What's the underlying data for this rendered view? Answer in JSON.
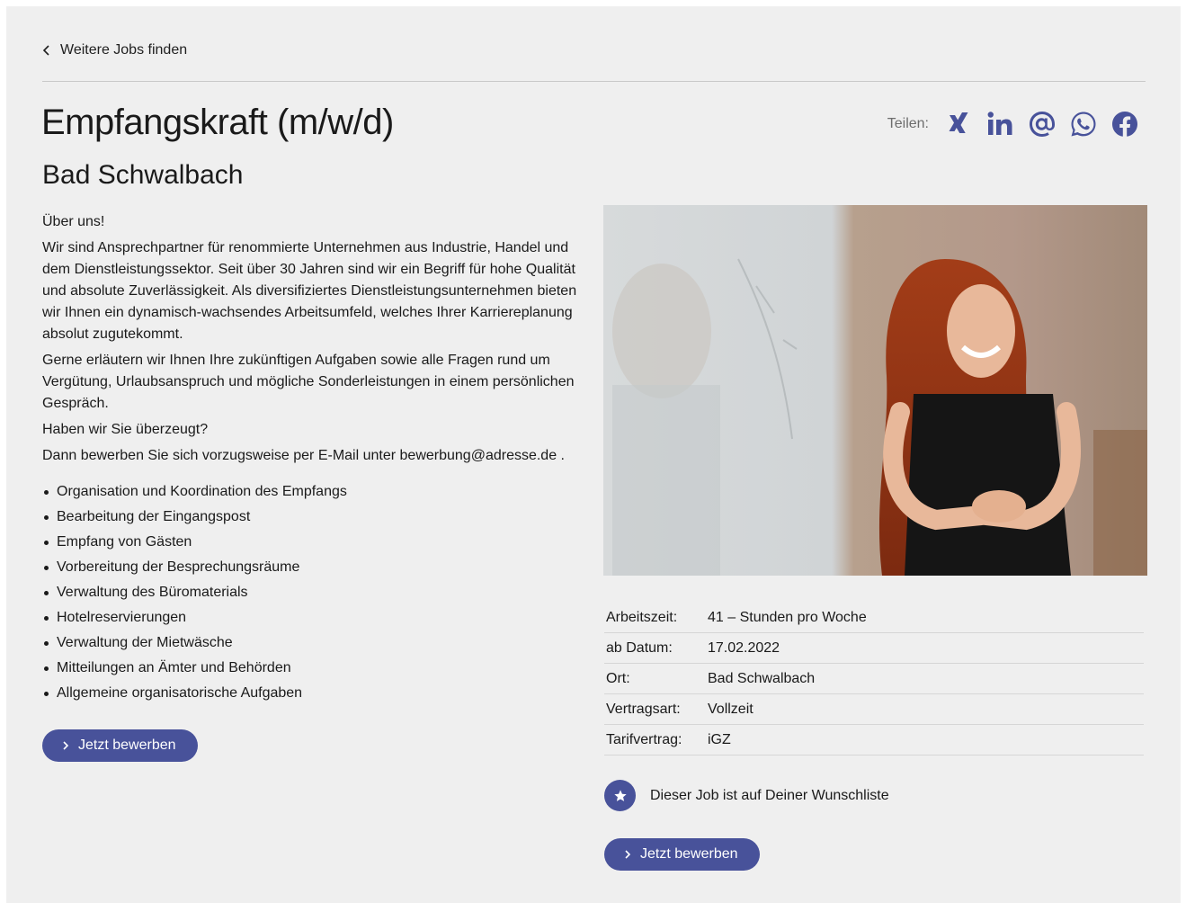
{
  "nav": {
    "back_label": "Weitere Jobs finden"
  },
  "job": {
    "title": "Empfangskraft (m/w/d)",
    "location": "Bad Schwalbach"
  },
  "share": {
    "label": "Teilen:",
    "icons": [
      "xing-icon",
      "linkedin-icon",
      "email-icon",
      "whatsapp-icon",
      "facebook-icon"
    ],
    "color": "#48529a"
  },
  "description": {
    "about_heading": "Über uns!",
    "about_text": "Wir sind Ansprechpartner für renommierte Unternehmen aus Industrie, Handel und dem Dienstleistungssektor. Seit über 30 Jahren sind wir ein Begriff für hohe Qualität und absolute Zuverlässigkeit. Als diversifiziertes Dienstleistungsunternehmen bieten wir Ihnen ein dynamisch-wachsendes Arbeitsumfeld, welches Ihrer Karriereplanung absolut zugutekommt.",
    "explain_text": "Gerne erläutern wir Ihnen Ihre zukünftigen Aufgaben sowie alle Fragen rund um Vergütung, Urlaubsanspruch und mögliche Sonderleistungen in einem persönlichen Gespräch.",
    "convinced_text": "Haben wir Sie überzeugt?",
    "apply_text": "Dann bewerben Sie sich vorzugsweise per E-Mail unter bewerbung@adresse.de ."
  },
  "tasks": [
    "Organisation und Koordination des Empfangs",
    "Bearbeitung der Eingangspost",
    "Empfang von Gästen",
    "Vorbereitung der Besprechungsräume",
    "Verwaltung des Büromaterials",
    "Hotelreservierungen",
    "Verwaltung der Mietwäsche",
    "Mitteilungen an Ämter und Behörden",
    "Allgemeine organisatorische Aufgaben"
  ],
  "apply_button_label": "Jetzt bewerben",
  "details": [
    {
      "key": "Arbeitszeit:",
      "value": "41 – Stunden pro Woche"
    },
    {
      "key": "ab Datum:",
      "value": "17.02.2022"
    },
    {
      "key": "Ort:",
      "value": "Bad Schwalbach"
    },
    {
      "key": "Vertragsart:",
      "value": "Vollzeit"
    },
    {
      "key": "Tarifvertrag:",
      "value": "iGZ"
    }
  ],
  "wishlist": {
    "label": "Dieser Job ist auf Deiner Wunschliste",
    "icon": "star-icon"
  },
  "colors": {
    "accent": "#48529a",
    "background": "#efefef",
    "text": "#1a1a1a"
  }
}
